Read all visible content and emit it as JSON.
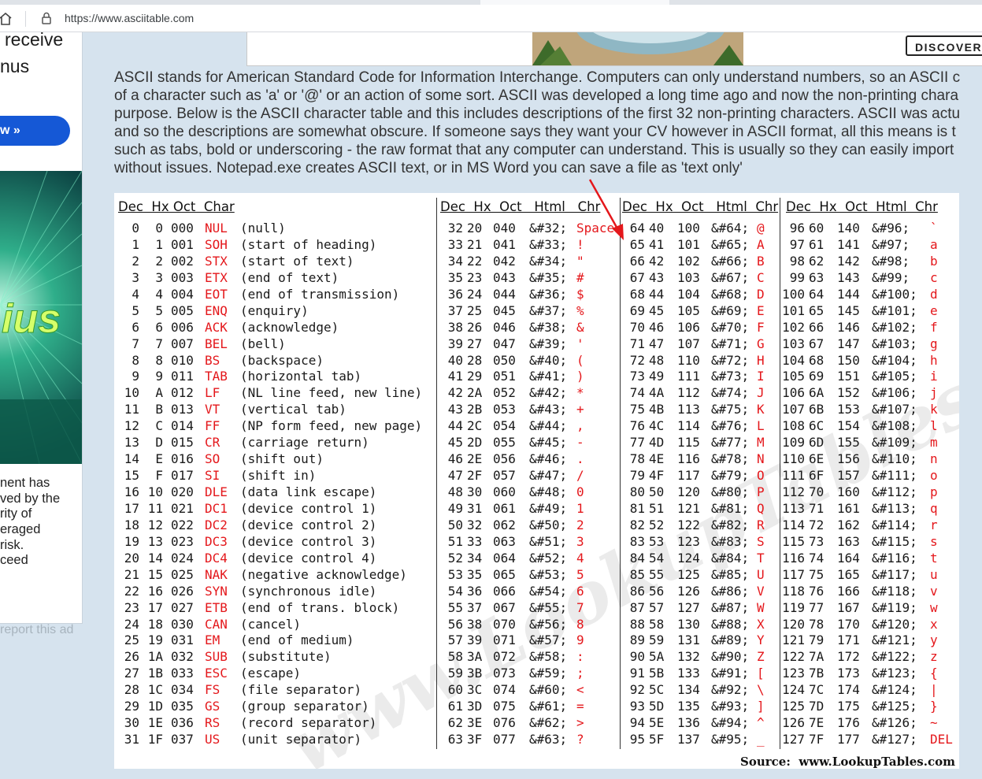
{
  "browser": {
    "url": "https://www.asciitable.com"
  },
  "left_ad": {
    "line1": "receive",
    "line2": "nus",
    "button_label": "w »",
    "image_text": "ius",
    "body_lines": [
      "nent has",
      "ved by the",
      "rity of",
      "eraged",
      "risk.",
      "ceed"
    ],
    "report_link": "report this ad"
  },
  "top_banner": {
    "button_label": "DISCOVER"
  },
  "intro_lines": [
    "ASCII stands for American Standard Code for Information Interchange. Computers can only understand numbers, so an ASCII c",
    "of a character such as 'a' or '@' or an action of some sort. ASCII was developed a long time ago and now the non-printing chara",
    "purpose. Below is the ASCII character table and this includes descriptions of the first 32 non-printing characters. ASCII was actu",
    "and so the descriptions are somewhat obscure. If someone says they want your CV however in ASCII format, all this means is t",
    "such as tabs, bold or underscoring - the raw format that any computer can understand. This is usually so they can easily import",
    "without issues. Notepad.exe creates ASCII text, or in MS Word you can save a file as 'text only'"
  ],
  "table": {
    "headers": {
      "col1": "Dec  Hx Oct  Char",
      "col2": "Dec  Hx  Oct   Html   Chr",
      "col3": "Dec  Hx  Oct   Html  Chr",
      "col4": "Dec  Hx  Oct  Html  Chr"
    },
    "control": [
      {
        "dec": "0",
        "hx": "0",
        "oct": "000",
        "abbr": "NUL",
        "desc": "(null)"
      },
      {
        "dec": "1",
        "hx": "1",
        "oct": "001",
        "abbr": "SOH",
        "desc": "(start of heading)"
      },
      {
        "dec": "2",
        "hx": "2",
        "oct": "002",
        "abbr": "STX",
        "desc": "(start of text)"
      },
      {
        "dec": "3",
        "hx": "3",
        "oct": "003",
        "abbr": "ETX",
        "desc": "(end of text)"
      },
      {
        "dec": "4",
        "hx": "4",
        "oct": "004",
        "abbr": "EOT",
        "desc": "(end of transmission)"
      },
      {
        "dec": "5",
        "hx": "5",
        "oct": "005",
        "abbr": "ENQ",
        "desc": "(enquiry)"
      },
      {
        "dec": "6",
        "hx": "6",
        "oct": "006",
        "abbr": "ACK",
        "desc": "(acknowledge)"
      },
      {
        "dec": "7",
        "hx": "7",
        "oct": "007",
        "abbr": "BEL",
        "desc": "(bell)"
      },
      {
        "dec": "8",
        "hx": "8",
        "oct": "010",
        "abbr": "BS",
        "desc": "(backspace)"
      },
      {
        "dec": "9",
        "hx": "9",
        "oct": "011",
        "abbr": "TAB",
        "desc": "(horizontal tab)"
      },
      {
        "dec": "10",
        "hx": "A",
        "oct": "012",
        "abbr": "LF",
        "desc": "(NL line feed, new line)"
      },
      {
        "dec": "11",
        "hx": "B",
        "oct": "013",
        "abbr": "VT",
        "desc": "(vertical tab)"
      },
      {
        "dec": "12",
        "hx": "C",
        "oct": "014",
        "abbr": "FF",
        "desc": "(NP form feed, new page)"
      },
      {
        "dec": "13",
        "hx": "D",
        "oct": "015",
        "abbr": "CR",
        "desc": "(carriage return)"
      },
      {
        "dec": "14",
        "hx": "E",
        "oct": "016",
        "abbr": "SO",
        "desc": "(shift out)"
      },
      {
        "dec": "15",
        "hx": "F",
        "oct": "017",
        "abbr": "SI",
        "desc": "(shift in)"
      },
      {
        "dec": "16",
        "hx": "10",
        "oct": "020",
        "abbr": "DLE",
        "desc": "(data link escape)"
      },
      {
        "dec": "17",
        "hx": "11",
        "oct": "021",
        "abbr": "DC1",
        "desc": "(device control 1)"
      },
      {
        "dec": "18",
        "hx": "12",
        "oct": "022",
        "abbr": "DC2",
        "desc": "(device control 2)"
      },
      {
        "dec": "19",
        "hx": "13",
        "oct": "023",
        "abbr": "DC3",
        "desc": "(device control 3)"
      },
      {
        "dec": "20",
        "hx": "14",
        "oct": "024",
        "abbr": "DC4",
        "desc": "(device control 4)"
      },
      {
        "dec": "21",
        "hx": "15",
        "oct": "025",
        "abbr": "NAK",
        "desc": "(negative acknowledge)"
      },
      {
        "dec": "22",
        "hx": "16",
        "oct": "026",
        "abbr": "SYN",
        "desc": "(synchronous idle)"
      },
      {
        "dec": "23",
        "hx": "17",
        "oct": "027",
        "abbr": "ETB",
        "desc": "(end of trans. block)"
      },
      {
        "dec": "24",
        "hx": "18",
        "oct": "030",
        "abbr": "CAN",
        "desc": "(cancel)"
      },
      {
        "dec": "25",
        "hx": "19",
        "oct": "031",
        "abbr": "EM",
        "desc": "(end of medium)"
      },
      {
        "dec": "26",
        "hx": "1A",
        "oct": "032",
        "abbr": "SUB",
        "desc": "(substitute)"
      },
      {
        "dec": "27",
        "hx": "1B",
        "oct": "033",
        "abbr": "ESC",
        "desc": "(escape)"
      },
      {
        "dec": "28",
        "hx": "1C",
        "oct": "034",
        "abbr": "FS",
        "desc": "(file separator)"
      },
      {
        "dec": "29",
        "hx": "1D",
        "oct": "035",
        "abbr": "GS",
        "desc": "(group separator)"
      },
      {
        "dec": "30",
        "hx": "1E",
        "oct": "036",
        "abbr": "RS",
        "desc": "(record separator)"
      },
      {
        "dec": "31",
        "hx": "1F",
        "oct": "037",
        "abbr": "US",
        "desc": "(unit separator)"
      }
    ],
    "printable": [
      [
        {
          "dec": "32",
          "hx": "20",
          "oct": "040",
          "html": "&#32;",
          "chr": "Space"
        },
        {
          "dec": "33",
          "hx": "21",
          "oct": "041",
          "html": "&#33;",
          "chr": "!"
        },
        {
          "dec": "34",
          "hx": "22",
          "oct": "042",
          "html": "&#34;",
          "chr": "\""
        },
        {
          "dec": "35",
          "hx": "23",
          "oct": "043",
          "html": "&#35;",
          "chr": "#"
        },
        {
          "dec": "36",
          "hx": "24",
          "oct": "044",
          "html": "&#36;",
          "chr": "$"
        },
        {
          "dec": "37",
          "hx": "25",
          "oct": "045",
          "html": "&#37;",
          "chr": "%"
        },
        {
          "dec": "38",
          "hx": "26",
          "oct": "046",
          "html": "&#38;",
          "chr": "&"
        },
        {
          "dec": "39",
          "hx": "27",
          "oct": "047",
          "html": "&#39;",
          "chr": "'"
        },
        {
          "dec": "40",
          "hx": "28",
          "oct": "050",
          "html": "&#40;",
          "chr": "("
        },
        {
          "dec": "41",
          "hx": "29",
          "oct": "051",
          "html": "&#41;",
          "chr": ")"
        },
        {
          "dec": "42",
          "hx": "2A",
          "oct": "052",
          "html": "&#42;",
          "chr": "*"
        },
        {
          "dec": "43",
          "hx": "2B",
          "oct": "053",
          "html": "&#43;",
          "chr": "+"
        },
        {
          "dec": "44",
          "hx": "2C",
          "oct": "054",
          "html": "&#44;",
          "chr": ","
        },
        {
          "dec": "45",
          "hx": "2D",
          "oct": "055",
          "html": "&#45;",
          "chr": "-"
        },
        {
          "dec": "46",
          "hx": "2E",
          "oct": "056",
          "html": "&#46;",
          "chr": "."
        },
        {
          "dec": "47",
          "hx": "2F",
          "oct": "057",
          "html": "&#47;",
          "chr": "/"
        },
        {
          "dec": "48",
          "hx": "30",
          "oct": "060",
          "html": "&#48;",
          "chr": "0"
        },
        {
          "dec": "49",
          "hx": "31",
          "oct": "061",
          "html": "&#49;",
          "chr": "1"
        },
        {
          "dec": "50",
          "hx": "32",
          "oct": "062",
          "html": "&#50;",
          "chr": "2"
        },
        {
          "dec": "51",
          "hx": "33",
          "oct": "063",
          "html": "&#51;",
          "chr": "3"
        },
        {
          "dec": "52",
          "hx": "34",
          "oct": "064",
          "html": "&#52;",
          "chr": "4"
        },
        {
          "dec": "53",
          "hx": "35",
          "oct": "065",
          "html": "&#53;",
          "chr": "5"
        },
        {
          "dec": "54",
          "hx": "36",
          "oct": "066",
          "html": "&#54;",
          "chr": "6"
        },
        {
          "dec": "55",
          "hx": "37",
          "oct": "067",
          "html": "&#55;",
          "chr": "7"
        },
        {
          "dec": "56",
          "hx": "38",
          "oct": "070",
          "html": "&#56;",
          "chr": "8"
        },
        {
          "dec": "57",
          "hx": "39",
          "oct": "071",
          "html": "&#57;",
          "chr": "9"
        },
        {
          "dec": "58",
          "hx": "3A",
          "oct": "072",
          "html": "&#58;",
          "chr": ":"
        },
        {
          "dec": "59",
          "hx": "3B",
          "oct": "073",
          "html": "&#59;",
          "chr": ";"
        },
        {
          "dec": "60",
          "hx": "3C",
          "oct": "074",
          "html": "&#60;",
          "chr": "<"
        },
        {
          "dec": "61",
          "hx": "3D",
          "oct": "075",
          "html": "&#61;",
          "chr": "="
        },
        {
          "dec": "62",
          "hx": "3E",
          "oct": "076",
          "html": "&#62;",
          "chr": ">"
        },
        {
          "dec": "63",
          "hx": "3F",
          "oct": "077",
          "html": "&#63;",
          "chr": "?"
        }
      ],
      [
        {
          "dec": "64",
          "hx": "40",
          "oct": "100",
          "html": "&#64;",
          "chr": "@"
        },
        {
          "dec": "65",
          "hx": "41",
          "oct": "101",
          "html": "&#65;",
          "chr": "A"
        },
        {
          "dec": "66",
          "hx": "42",
          "oct": "102",
          "html": "&#66;",
          "chr": "B"
        },
        {
          "dec": "67",
          "hx": "43",
          "oct": "103",
          "html": "&#67;",
          "chr": "C"
        },
        {
          "dec": "68",
          "hx": "44",
          "oct": "104",
          "html": "&#68;",
          "chr": "D"
        },
        {
          "dec": "69",
          "hx": "45",
          "oct": "105",
          "html": "&#69;",
          "chr": "E"
        },
        {
          "dec": "70",
          "hx": "46",
          "oct": "106",
          "html": "&#70;",
          "chr": "F"
        },
        {
          "dec": "71",
          "hx": "47",
          "oct": "107",
          "html": "&#71;",
          "chr": "G"
        },
        {
          "dec": "72",
          "hx": "48",
          "oct": "110",
          "html": "&#72;",
          "chr": "H"
        },
        {
          "dec": "73",
          "hx": "49",
          "oct": "111",
          "html": "&#73;",
          "chr": "I"
        },
        {
          "dec": "74",
          "hx": "4A",
          "oct": "112",
          "html": "&#74;",
          "chr": "J"
        },
        {
          "dec": "75",
          "hx": "4B",
          "oct": "113",
          "html": "&#75;",
          "chr": "K"
        },
        {
          "dec": "76",
          "hx": "4C",
          "oct": "114",
          "html": "&#76;",
          "chr": "L"
        },
        {
          "dec": "77",
          "hx": "4D",
          "oct": "115",
          "html": "&#77;",
          "chr": "M"
        },
        {
          "dec": "78",
          "hx": "4E",
          "oct": "116",
          "html": "&#78;",
          "chr": "N"
        },
        {
          "dec": "79",
          "hx": "4F",
          "oct": "117",
          "html": "&#79;",
          "chr": "O"
        },
        {
          "dec": "80",
          "hx": "50",
          "oct": "120",
          "html": "&#80;",
          "chr": "P"
        },
        {
          "dec": "81",
          "hx": "51",
          "oct": "121",
          "html": "&#81;",
          "chr": "Q"
        },
        {
          "dec": "82",
          "hx": "52",
          "oct": "122",
          "html": "&#82;",
          "chr": "R"
        },
        {
          "dec": "83",
          "hx": "53",
          "oct": "123",
          "html": "&#83;",
          "chr": "S"
        },
        {
          "dec": "84",
          "hx": "54",
          "oct": "124",
          "html": "&#84;",
          "chr": "T"
        },
        {
          "dec": "85",
          "hx": "55",
          "oct": "125",
          "html": "&#85;",
          "chr": "U"
        },
        {
          "dec": "86",
          "hx": "56",
          "oct": "126",
          "html": "&#86;",
          "chr": "V"
        },
        {
          "dec": "87",
          "hx": "57",
          "oct": "127",
          "html": "&#87;",
          "chr": "W"
        },
        {
          "dec": "88",
          "hx": "58",
          "oct": "130",
          "html": "&#88;",
          "chr": "X"
        },
        {
          "dec": "89",
          "hx": "59",
          "oct": "131",
          "html": "&#89;",
          "chr": "Y"
        },
        {
          "dec": "90",
          "hx": "5A",
          "oct": "132",
          "html": "&#90;",
          "chr": "Z"
        },
        {
          "dec": "91",
          "hx": "5B",
          "oct": "133",
          "html": "&#91;",
          "chr": "["
        },
        {
          "dec": "92",
          "hx": "5C",
          "oct": "134",
          "html": "&#92;",
          "chr": "\\"
        },
        {
          "dec": "93",
          "hx": "5D",
          "oct": "135",
          "html": "&#93;",
          "chr": "]"
        },
        {
          "dec": "94",
          "hx": "5E",
          "oct": "136",
          "html": "&#94;",
          "chr": "^"
        },
        {
          "dec": "95",
          "hx": "5F",
          "oct": "137",
          "html": "&#95;",
          "chr": "_"
        }
      ],
      [
        {
          "dec": "96",
          "hx": "60",
          "oct": "140",
          "html": "&#96;",
          "chr": "`"
        },
        {
          "dec": "97",
          "hx": "61",
          "oct": "141",
          "html": "&#97;",
          "chr": "a"
        },
        {
          "dec": "98",
          "hx": "62",
          "oct": "142",
          "html": "&#98;",
          "chr": "b"
        },
        {
          "dec": "99",
          "hx": "63",
          "oct": "143",
          "html": "&#99;",
          "chr": "c"
        },
        {
          "dec": "100",
          "hx": "64",
          "oct": "144",
          "html": "&#100;",
          "chr": "d"
        },
        {
          "dec": "101",
          "hx": "65",
          "oct": "145",
          "html": "&#101;",
          "chr": "e"
        },
        {
          "dec": "102",
          "hx": "66",
          "oct": "146",
          "html": "&#102;",
          "chr": "f"
        },
        {
          "dec": "103",
          "hx": "67",
          "oct": "147",
          "html": "&#103;",
          "chr": "g"
        },
        {
          "dec": "104",
          "hx": "68",
          "oct": "150",
          "html": "&#104;",
          "chr": "h"
        },
        {
          "dec": "105",
          "hx": "69",
          "oct": "151",
          "html": "&#105;",
          "chr": "i"
        },
        {
          "dec": "106",
          "hx": "6A",
          "oct": "152",
          "html": "&#106;",
          "chr": "j"
        },
        {
          "dec": "107",
          "hx": "6B",
          "oct": "153",
          "html": "&#107;",
          "chr": "k"
        },
        {
          "dec": "108",
          "hx": "6C",
          "oct": "154",
          "html": "&#108;",
          "chr": "l"
        },
        {
          "dec": "109",
          "hx": "6D",
          "oct": "155",
          "html": "&#109;",
          "chr": "m"
        },
        {
          "dec": "110",
          "hx": "6E",
          "oct": "156",
          "html": "&#110;",
          "chr": "n"
        },
        {
          "dec": "111",
          "hx": "6F",
          "oct": "157",
          "html": "&#111;",
          "chr": "o"
        },
        {
          "dec": "112",
          "hx": "70",
          "oct": "160",
          "html": "&#112;",
          "chr": "p"
        },
        {
          "dec": "113",
          "hx": "71",
          "oct": "161",
          "html": "&#113;",
          "chr": "q"
        },
        {
          "dec": "114",
          "hx": "72",
          "oct": "162",
          "html": "&#114;",
          "chr": "r"
        },
        {
          "dec": "115",
          "hx": "73",
          "oct": "163",
          "html": "&#115;",
          "chr": "s"
        },
        {
          "dec": "116",
          "hx": "74",
          "oct": "164",
          "html": "&#116;",
          "chr": "t"
        },
        {
          "dec": "117",
          "hx": "75",
          "oct": "165",
          "html": "&#117;",
          "chr": "u"
        },
        {
          "dec": "118",
          "hx": "76",
          "oct": "166",
          "html": "&#118;",
          "chr": "v"
        },
        {
          "dec": "119",
          "hx": "77",
          "oct": "167",
          "html": "&#119;",
          "chr": "w"
        },
        {
          "dec": "120",
          "hx": "78",
          "oct": "170",
          "html": "&#120;",
          "chr": "x"
        },
        {
          "dec": "121",
          "hx": "79",
          "oct": "171",
          "html": "&#121;",
          "chr": "y"
        },
        {
          "dec": "122",
          "hx": "7A",
          "oct": "172",
          "html": "&#122;",
          "chr": "z"
        },
        {
          "dec": "123",
          "hx": "7B",
          "oct": "173",
          "html": "&#123;",
          "chr": "{"
        },
        {
          "dec": "124",
          "hx": "7C",
          "oct": "174",
          "html": "&#124;",
          "chr": "|"
        },
        {
          "dec": "125",
          "hx": "7D",
          "oct": "175",
          "html": "&#125;",
          "chr": "}"
        },
        {
          "dec": "126",
          "hx": "7E",
          "oct": "176",
          "html": "&#126;",
          "chr": "~"
        },
        {
          "dec": "127",
          "hx": "7F",
          "oct": "177",
          "html": "&#127;",
          "chr": "DEL"
        }
      ]
    ],
    "watermark": "www.LookupTables.com",
    "source_label": "Source:",
    "source_site": "www.LookupTables.com"
  },
  "colors": {
    "accent_red": "#e4171b",
    "page_bg": "#d6e3ee",
    "ad_button": "#1558d6"
  }
}
